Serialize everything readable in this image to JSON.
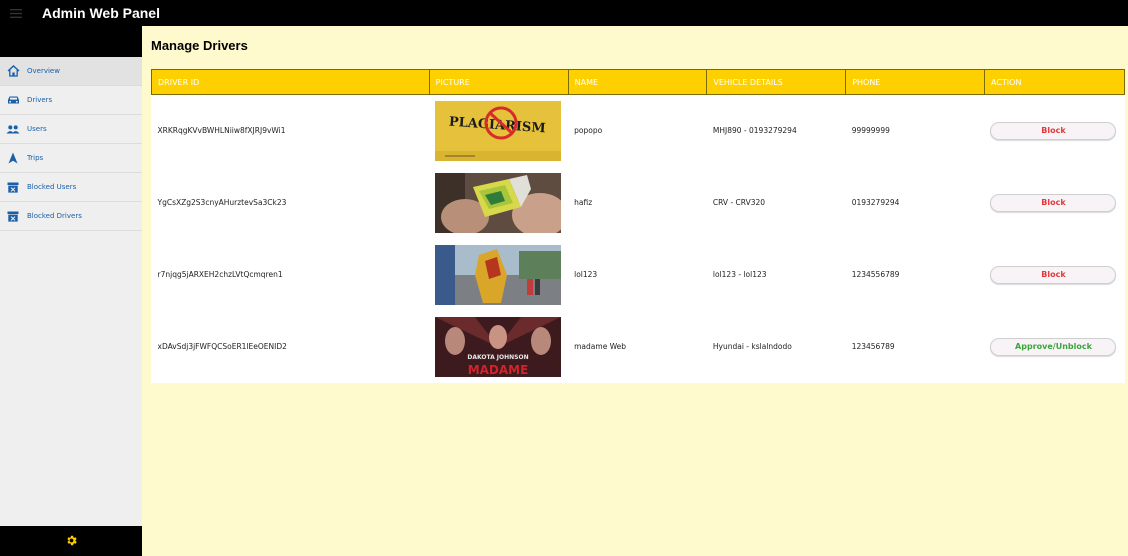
{
  "app": {
    "title": "Admin Web Panel"
  },
  "sidebar": {
    "items": [
      {
        "label": "Overview",
        "icon": "home-icon"
      },
      {
        "label": "Drivers",
        "icon": "car-icon"
      },
      {
        "label": "Users",
        "icon": "users-icon"
      },
      {
        "label": "Trips",
        "icon": "navigation-icon"
      },
      {
        "label": "Blocked Users",
        "icon": "block-box-icon"
      },
      {
        "label": "Blocked Drivers",
        "icon": "block-box-icon"
      }
    ],
    "footer_icon": "gear-icon"
  },
  "page": {
    "title": "Manage Drivers"
  },
  "table": {
    "headers": [
      "DRIVER ID",
      "PICTURE",
      "NAME",
      "VEHICLE DETAILS",
      "PHONE",
      "ACTION"
    ],
    "rows": [
      {
        "driver_id": "XRKRqgKVvBWHLNiiw8fXJRJ9vWi1",
        "picture": "plagiarism-image",
        "name": "popopo",
        "vehicle": "MHJ890 - 0193279294",
        "phone": "99999999",
        "action": "Block"
      },
      {
        "driver_id": "YgCsXZg2S3cnyAHurztevSa3Ck23",
        "picture": "candy-image",
        "name": "hafiz",
        "vehicle": "CRV - CRV320",
        "phone": "0193279294",
        "action": "Block"
      },
      {
        "driver_id": "r7njqg5jARXEH2chzLVtQcmqren1",
        "picture": "street-costume-image",
        "name": "lol123",
        "vehicle": "lol123 - lol123",
        "phone": "1234556789",
        "action": "Block"
      },
      {
        "driver_id": "xDAvSdj3jFWFQCSoER1lEeOENID2",
        "picture": "movie-poster-image",
        "name": "madame Web",
        "vehicle": "Hyundai - kslalndodo",
        "phone": "123456789",
        "action": "Approve/Unblock"
      }
    ]
  },
  "images": {
    "plagiarism_text": "PLAGIARISM",
    "poster_text_1": "DAKOTA JOHNSON",
    "poster_text_2": "MADAME"
  },
  "colors": {
    "topbar": "#000000",
    "background": "#fffacd",
    "header": "#ffd000",
    "block": "#e03b3b",
    "approve": "#3aa63a",
    "nav_text": "#1a5fa8"
  }
}
